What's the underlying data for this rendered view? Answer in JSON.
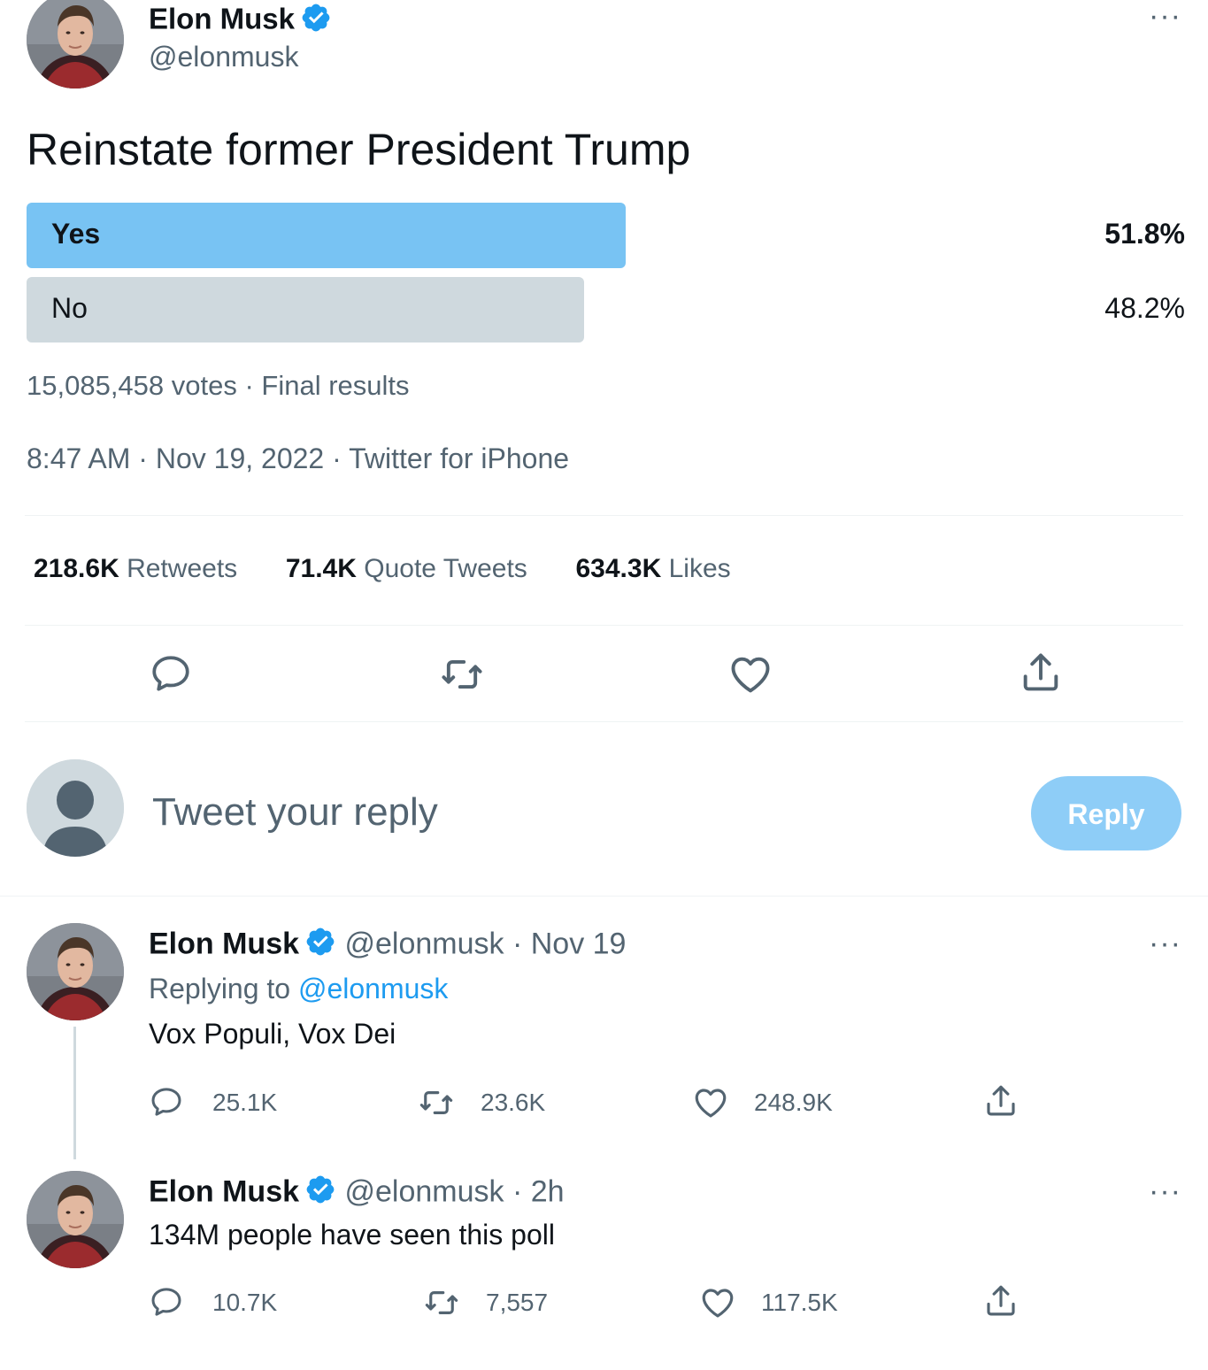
{
  "tweet": {
    "author_name": "Elon Musk",
    "author_handle": "@elonmusk",
    "text": "Reinstate former President Trump",
    "poll": {
      "options": [
        {
          "label": "Yes",
          "percent": "51.8%",
          "share": 0.518,
          "leading": true
        },
        {
          "label": "No",
          "percent": "48.2%",
          "share": 0.482,
          "leading": false
        }
      ],
      "summary": "15,085,458 votes · Final results"
    },
    "meta": "8:47 AM · Nov 19, 2022 · Twitter for iPhone",
    "stats": [
      {
        "count": "218.6K",
        "label": "Retweets"
      },
      {
        "count": "71.4K",
        "label": "Quote Tweets"
      },
      {
        "count": "634.3K",
        "label": "Likes"
      }
    ]
  },
  "compose": {
    "placeholder": "Tweet your reply",
    "button_label": "Reply"
  },
  "replies": [
    {
      "author_name": "Elon Musk",
      "author_handle": "@elonmusk",
      "time": "· Nov 19",
      "replying_prefix": "Replying to",
      "replying_handle": "@elonmusk",
      "text": "Vox Populi, Vox Dei",
      "replies": "25.1K",
      "retweets": "23.6K",
      "likes": "248.9K"
    },
    {
      "author_name": "Elon Musk",
      "author_handle": "@elonmusk",
      "time": "· 2h",
      "text": "134M people have seen this poll",
      "replies": "10.7K",
      "retweets": "7,557",
      "likes": "117.5K"
    }
  ],
  "colors": {
    "accent": "#1d9bf0",
    "poll_winner": "#78c3f3",
    "poll_loser": "#cfd9de",
    "reply_button": "#8ecdf7"
  },
  "icons": [
    "more-icon",
    "verified-icon",
    "reply-icon",
    "retweet-icon",
    "like-icon",
    "share-icon",
    "default-avatar-icon"
  ]
}
